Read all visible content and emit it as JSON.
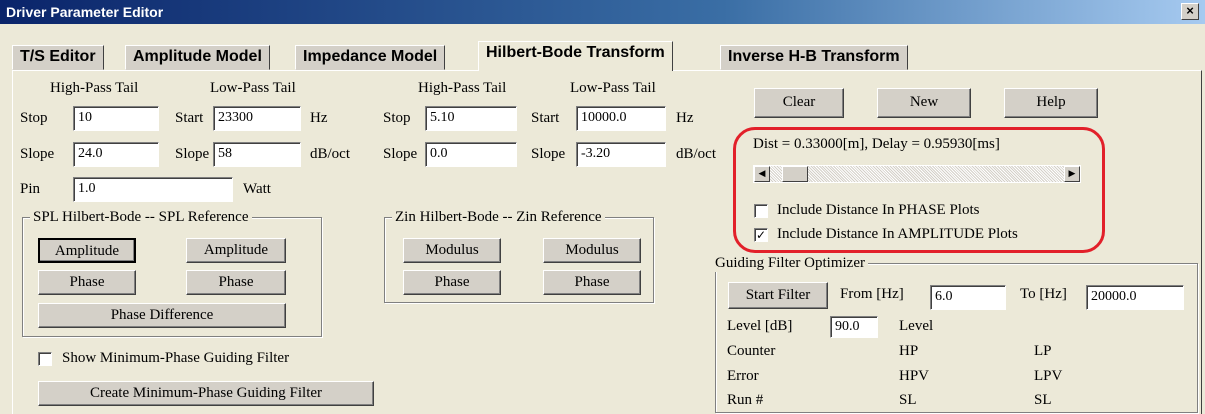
{
  "window": {
    "title": "Driver Parameter Editor",
    "close": "×"
  },
  "tabs": [
    "T/S Editor",
    "Amplitude Model",
    "Impedance Model",
    "Hilbert-Bode Transform",
    "Inverse H-B Transform"
  ],
  "left": {
    "hp_header": "High-Pass Tail",
    "lp_header": "Low-Pass Tail",
    "stop_label": "Stop",
    "stop_value": "10",
    "start_label": "Start",
    "start_value": "23300",
    "hz": "Hz",
    "slope_label": "Slope",
    "slope_hp": "24.0",
    "slope_lp": "58",
    "dboct": "dB/oct",
    "pin_label": "Pin",
    "pin_value": "1.0",
    "watt": "Watt"
  },
  "right": {
    "hp_header": "High-Pass Tail",
    "lp_header": "Low-Pass Tail",
    "stop_label": "Stop",
    "stop_value": "5.10",
    "start_label": "Start",
    "start_value": "10000.0",
    "hz": "Hz",
    "slope_label": "Slope",
    "slope_hp": "0.0",
    "slope_lp": "-3.20",
    "dboct": "dB/oct"
  },
  "spl_group": {
    "title": "SPL Hilbert-Bode -- SPL Reference",
    "amp1": "Amplitude",
    "amp2": "Amplitude",
    "phase1": "Phase",
    "phase2": "Phase",
    "phase_diff": "Phase Difference"
  },
  "zin_group": {
    "title": "Zin Hilbert-Bode -- Zin Reference",
    "mod1": "Modulus",
    "mod2": "Modulus",
    "phase1": "Phase",
    "phase2": "Phase"
  },
  "guiding": {
    "show_label": "Show Minimum-Phase Guiding Filter",
    "show_checked": false,
    "create_label": "Create Minimum-Phase Guiding Filter"
  },
  "top_buttons": {
    "clear": "Clear",
    "new": "New",
    "help": "Help"
  },
  "distance": {
    "readout": "Dist = 0.33000[m], Delay = 0.95930[ms]",
    "phase_label": "Include Distance In PHASE Plots",
    "phase_checked": false,
    "amp_label": "Include Distance In AMPLITUDE Plots",
    "amp_checked": true,
    "check_mark": "✓"
  },
  "optimizer": {
    "title": "Guiding Filter Optimizer",
    "start_button": "Start Filter",
    "from_label": "From [Hz]",
    "from_value": "6.0",
    "to_label": "To [Hz]",
    "to_value": "20000.0",
    "level_label": "Level [dB]",
    "level_value": "90.0",
    "level_text": "Level",
    "rows": [
      {
        "label": "Counter",
        "hp": "HP",
        "lp": "LP"
      },
      {
        "label": "Error",
        "hp": "HPV",
        "lp": "LPV"
      },
      {
        "label": "Run #",
        "hp": "SL",
        "lp": "SL"
      }
    ]
  },
  "colors": {
    "highlight": "#e2202a",
    "titlebar": "#0a246a"
  }
}
